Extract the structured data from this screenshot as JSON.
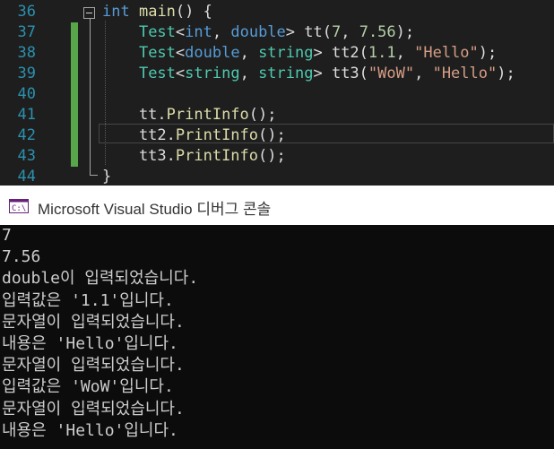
{
  "editor": {
    "lines": [
      {
        "num": "36",
        "parts": [
          {
            "t": "int",
            "c": "kw"
          },
          {
            "t": " ",
            "c": "pl"
          },
          {
            "t": "main",
            "c": "fn"
          },
          {
            "t": "() {",
            "c": "pl"
          }
        ]
      },
      {
        "num": "37",
        "parts": [
          {
            "t": "    ",
            "c": "pl"
          },
          {
            "t": "Test",
            "c": "ty"
          },
          {
            "t": "<",
            "c": "pl"
          },
          {
            "t": "int",
            "c": "kw"
          },
          {
            "t": ", ",
            "c": "pl"
          },
          {
            "t": "double",
            "c": "kw"
          },
          {
            "t": "> tt(",
            "c": "pl"
          },
          {
            "t": "7",
            "c": "num"
          },
          {
            "t": ", ",
            "c": "pl"
          },
          {
            "t": "7.56",
            "c": "num"
          },
          {
            "t": ");",
            "c": "pl"
          }
        ]
      },
      {
        "num": "38",
        "parts": [
          {
            "t": "    ",
            "c": "pl"
          },
          {
            "t": "Test",
            "c": "ty"
          },
          {
            "t": "<",
            "c": "pl"
          },
          {
            "t": "double",
            "c": "kw"
          },
          {
            "t": ", ",
            "c": "pl"
          },
          {
            "t": "string",
            "c": "ty"
          },
          {
            "t": "> tt2(",
            "c": "pl"
          },
          {
            "t": "1.1",
            "c": "num"
          },
          {
            "t": ", ",
            "c": "pl"
          },
          {
            "t": "\"Hello\"",
            "c": "str"
          },
          {
            "t": ");",
            "c": "pl"
          }
        ]
      },
      {
        "num": "39",
        "parts": [
          {
            "t": "    ",
            "c": "pl"
          },
          {
            "t": "Test",
            "c": "ty"
          },
          {
            "t": "<",
            "c": "pl"
          },
          {
            "t": "string",
            "c": "ty"
          },
          {
            "t": ", ",
            "c": "pl"
          },
          {
            "t": "string",
            "c": "ty"
          },
          {
            "t": "> tt3(",
            "c": "pl"
          },
          {
            "t": "\"WoW\"",
            "c": "str"
          },
          {
            "t": ", ",
            "c": "pl"
          },
          {
            "t": "\"Hello\"",
            "c": "str"
          },
          {
            "t": ");",
            "c": "pl"
          }
        ]
      },
      {
        "num": "40",
        "parts": []
      },
      {
        "num": "41",
        "parts": [
          {
            "t": "    tt.",
            "c": "pl"
          },
          {
            "t": "PrintInfo",
            "c": "fn"
          },
          {
            "t": "();",
            "c": "pl"
          }
        ]
      },
      {
        "num": "42",
        "parts": [
          {
            "t": "    tt2.",
            "c": "pl"
          },
          {
            "t": "PrintInfo",
            "c": "fn"
          },
          {
            "t": "();",
            "c": "pl"
          }
        ]
      },
      {
        "num": "43",
        "parts": [
          {
            "t": "    tt3.",
            "c": "pl"
          },
          {
            "t": "PrintInfo",
            "c": "fn"
          },
          {
            "t": "();",
            "c": "pl"
          }
        ]
      },
      {
        "num": "44",
        "parts": [
          {
            "t": "}",
            "c": "pl"
          }
        ]
      }
    ],
    "changed_lines": [
      "37",
      "38",
      "39",
      "40",
      "41",
      "42",
      "43"
    ],
    "current_line": "42"
  },
  "console": {
    "icon": "console-app-icon",
    "title": "Microsoft Visual Studio 디버그 콘솔",
    "output": [
      "7",
      "7.56",
      "double이 입력되었습니다.",
      "입력값은 '1.1'입니다.",
      "문자열이 입력되었습니다.",
      "내용은 'Hello'입니다.",
      "문자열이 입력되었습니다.",
      "입력값은 'WoW'입니다.",
      "문자열이 입력되었습니다.",
      "내용은 'Hello'입니다."
    ]
  },
  "colors": {
    "editor_bg": "#1e1e1e",
    "line_number": "#2b91af",
    "keyword": "#569cd6",
    "type": "#4ec9b0",
    "function": "#dcdcaa",
    "string": "#d69d85",
    "number": "#b5cea8",
    "change_bar": "#57a64a",
    "console_bg": "#0c0c0c",
    "console_text": "#cccccc"
  }
}
